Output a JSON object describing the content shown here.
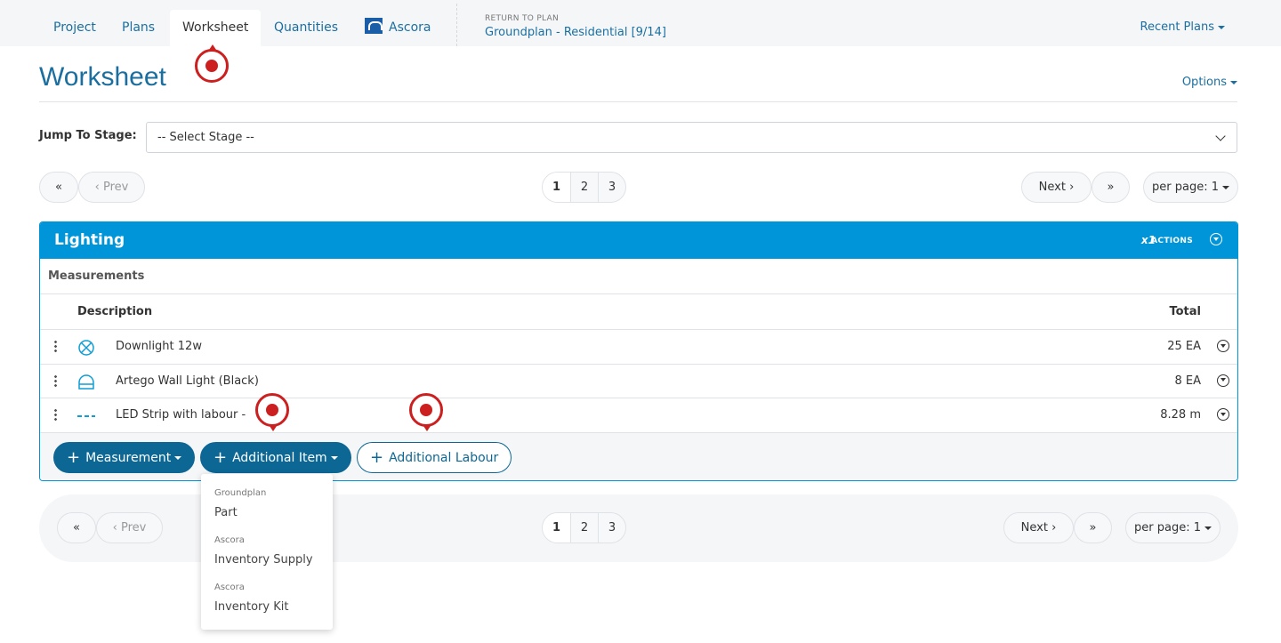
{
  "nav": {
    "tabs": [
      "Project",
      "Plans",
      "Worksheet",
      "Quantities",
      "Ascora"
    ],
    "active": "Worksheet",
    "return_label": "RETURN TO PLAN",
    "return_link": "Groundplan - Residential [9/14]",
    "recent_plans": "Recent Plans"
  },
  "page": {
    "title": "Worksheet",
    "options": "Options",
    "jump_label": "Jump To Stage:",
    "select_value": "-- Select Stage --"
  },
  "pager": {
    "first": "«",
    "prev": "Prev",
    "pages": [
      "1",
      "2",
      "3"
    ],
    "current": "1",
    "next": "Next",
    "last": "»",
    "per_page": "per page: 1"
  },
  "panel": {
    "title": "Lighting",
    "multiplier": "x1",
    "actions": "ACTIONS",
    "section": "Measurements",
    "col_description": "Description",
    "col_total": "Total",
    "rows": [
      {
        "icon": "downlight-icon",
        "description": "Downlight 12w",
        "total": "25 EA"
      },
      {
        "icon": "wall-light-icon",
        "description": "Artego Wall Light (Black)",
        "total": "8 EA"
      },
      {
        "icon": "dashed-line-icon",
        "description": "LED Strip with labour -",
        "total": "8.28 m"
      }
    ],
    "buttons": {
      "measurement": "Measurement",
      "additional_item": "Additional Item",
      "additional_labour": "Additional Labour"
    }
  },
  "dropdown": [
    {
      "group": "Groundplan",
      "item": "Part"
    },
    {
      "group": "Ascora",
      "item": "Inventory Supply"
    },
    {
      "group": "Ascora",
      "item": "Inventory Kit"
    }
  ],
  "colors": {
    "primary": "#0095d9",
    "button": "#0c6795",
    "link": "#1a6fa0",
    "marker": "#cc1f1f"
  }
}
